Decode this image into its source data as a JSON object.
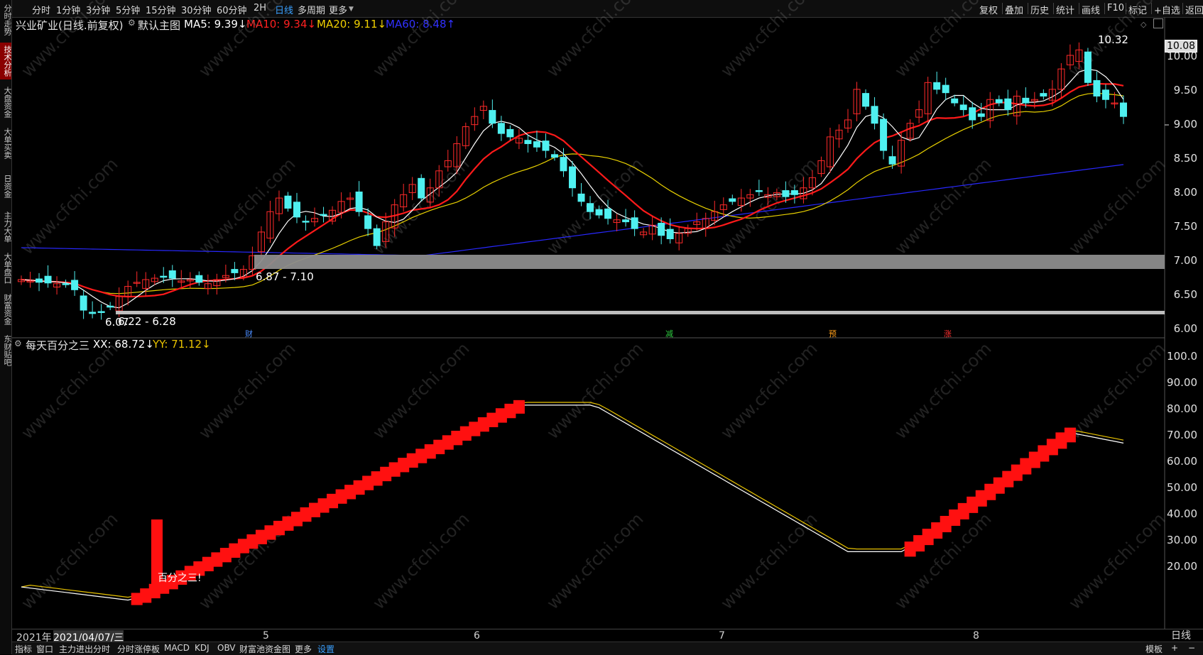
{
  "left_tabs": [
    "分时走势",
    "技术分析",
    "大盘资金",
    "大单买卖",
    "日资金",
    "主力大单",
    "大单盘口",
    "财富资金",
    "东财贴吧"
  ],
  "periods": [
    "分时",
    "1分钟",
    "3分钟",
    "5分钟",
    "15分钟",
    "30分钟",
    "60分钟",
    "2H",
    "日线",
    "多周期",
    "更多"
  ],
  "active_period": "日线",
  "right_tools": [
    "复权",
    "叠加",
    "历史",
    "统计",
    "画线",
    "F10",
    "标记",
    "+自选",
    "返回"
  ],
  "main_info": {
    "title": "兴业矿业(日线.前复权)",
    "chart_name": "默认主图",
    "ma5": "MA5: 9.39↓",
    "ma10": "MA10: 9.34↓",
    "ma20": "MA20: 9.11↓",
    "ma60": "MA60: 8.48↑"
  },
  "sub_info": {
    "title": "每天百分之三",
    "xx": "XX: 68.72↓",
    "yy": "YY: 71.12↓",
    "annotation": "百分之三!"
  },
  "price_axis": [
    "10.00",
    "9.50",
    "9.00",
    "8.50",
    "8.00",
    "7.50",
    "7.00",
    "6.50",
    "6.00"
  ],
  "current_price": "10.08",
  "sub_axis": [
    "100.0",
    "90.00",
    "80.00",
    "70.00",
    "60.00",
    "50.00",
    "40.00",
    "30.00",
    "20.00"
  ],
  "zones": [
    {
      "label": "6.87 - 7.10"
    },
    {
      "label": "6.22 - 6.28"
    }
  ],
  "hi_label": "10.32",
  "lo_label": "6.07",
  "event_markers": [
    {
      "text": "财",
      "color": "#4a8cff"
    },
    {
      "text": "减",
      "color": "#2ecc40"
    },
    {
      "text": "预",
      "color": "#ff9f1a"
    },
    {
      "text": "涨",
      "color": "#ff3030"
    }
  ],
  "dates": {
    "start": "2021年",
    "cursor": "2021/04/07/三",
    "m5": "5",
    "m6": "6",
    "m7": "7",
    "m8": "8"
  },
  "bottom_tabs": [
    "指标",
    "窗口",
    "主力进出分时",
    "分时涨停板",
    "MACD",
    "KDJ",
    "OBV",
    "财富池资金图",
    "更多",
    "设置"
  ],
  "bottom_right": [
    "模板",
    "日线",
    "+",
    "−"
  ],
  "watermark": "www.cfchi.com",
  "colors": {
    "up": "#ff2a2a",
    "down": "#4ff0f0",
    "ma5": "#ffffff",
    "ma10": "#ff1a1a",
    "ma20": "#e8d000",
    "ma60": "#2828ff",
    "accent": "#3aa0ff"
  }
}
